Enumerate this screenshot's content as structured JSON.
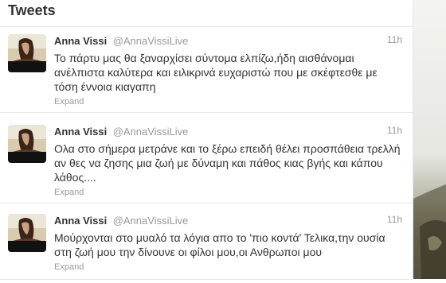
{
  "stream": {
    "title": "Tweets",
    "tweets": [
      {
        "fullname": "Anna Vissi",
        "username": "@AnnaVissiLive",
        "time": "11h",
        "text": "Το πάρτυ μας θα ξαναρχίσει σύντομα ελπίζω,ήδη αισθάνομαι ανέλπιστα καλύτερα και ειλικρινά ευχαριστώ που με σκέφτεσθε με τόση έννοια κιαγαπη",
        "expand": "Expand"
      },
      {
        "fullname": "Anna Vissi",
        "username": "@AnnaVissiLive",
        "time": "11h",
        "text": "Ολα στο σήμερα μετράνε και το ξέρω επειδή θέλει προσπάθεια τρελλή αν θες να ζησης μια ζωή με δύναμη και πάθος κιας βγής και κάπου λάθος....",
        "expand": "Expand"
      },
      {
        "fullname": "Anna Vissi",
        "username": "@AnnaVissiLive",
        "time": "11h",
        "text": "Μούρχονται στο μυαλό τα λόγια απο το 'πιο κοντά' Τελικα,την ουσία στη ζωή μου την δίνουνε οι φίλοι μου,οι Ανθρωποι μου",
        "expand": "Expand"
      }
    ]
  }
}
